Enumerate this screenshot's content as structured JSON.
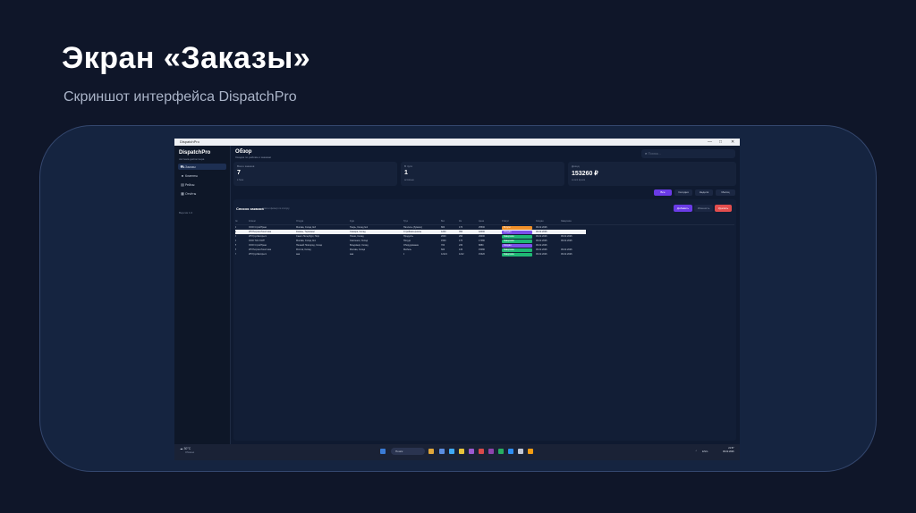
{
  "slide": {
    "title": "Экран «Заказы»",
    "subtitle": "Скриншот интерфейса DispatchPro"
  },
  "window": {
    "title": "DispatchPro",
    "controls": [
      "—",
      "□",
      "✕"
    ]
  },
  "sidebar": {
    "brand": "DispatchPro",
    "brand_sub": "система диспетчера",
    "items": [
      {
        "label": "Заказы",
        "icon": "truck-icon",
        "active": true
      },
      {
        "label": "Клиенты",
        "icon": "user-icon",
        "active": false
      },
      {
        "label": "Рейсы",
        "icon": "route-icon",
        "active": false
      },
      {
        "label": "Отчёты",
        "icon": "report-icon",
        "active": false
      }
    ],
    "version": "Версия 1.0"
  },
  "main": {
    "title": "Обзор",
    "subtitle": "Сводка по рейсам и заказам",
    "search_placeholder": "Поиск...",
    "cards": [
      {
        "label": "Всего заказов",
        "value": "7",
        "caption": "в базе"
      },
      {
        "label": "В пути",
        "value": "1",
        "caption": "активные"
      },
      {
        "label": "Доход",
        "value": "153260 ₽",
        "caption": "за всё время"
      }
    ],
    "filters": [
      {
        "label": "Все",
        "active": true
      },
      {
        "label": "Сегодня",
        "active": false
      },
      {
        "label": "Неделя",
        "active": false
      },
      {
        "label": "Месяц",
        "active": false
      }
    ],
    "orders": {
      "title": "Список заказов",
      "hint": "поиск и фильтр по статусу",
      "buttons": {
        "add": "Добавить",
        "edit": "Изменить",
        "delete": "Удалить"
      },
      "columns": [
        "№",
        "Клиент",
        "Откуда",
        "Куда",
        "Груз",
        "Вес",
        "Км",
        "Цена",
        "Статус",
        "Создан",
        "Завершён"
      ],
      "rows": [
        [
          "1",
          "ООО СтройТранс",
          "Москва, Склад №3",
          "Тверь, Склад №1",
          "Паллеты (бумага)",
          "800",
          "170",
          "25500",
          "В пути",
          "09.02.2026",
          ""
        ],
        [
          "2",
          "ИП Петров Логистика",
          "Казань, Терминал",
          "Самара, Склад",
          "Стройматериалы",
          "1200",
          "350",
          "42000",
          "Создан",
          "09.02.2026",
          ""
        ],
        [
          "3",
          "ИП ГрузЭкспресс",
          "Санкт-Петербург, Порт",
          "Псков, Склад",
          "Продукты",
          "2000",
          "290",
          "29000",
          "Завершён",
          "09.02.2026",
          "09.02.2026"
        ],
        [
          "4",
          "ООО ТАУ-ТАУП",
          "Москва, Склад №1",
          "Смоленск, Склад",
          "Посуда",
          "1500",
          "170",
          "17480",
          "Завершён",
          "09.02.2026",
          "09.02.2026"
        ],
        [
          "5",
          "ООО СтройТранс",
          "Нижний Новгород, Склад",
          "Владимир, Склад",
          "Оборудование",
          "700",
          "230",
          "8880",
          "Создан",
          "09.02.2026",
          ""
        ],
        [
          "6",
          "ИП Петров Логистика",
          "Ростов, Склад",
          "Москва, Склад",
          "Мебель",
          "600",
          "130",
          "15080",
          "Завершён",
          "09.02.2026",
          "09.02.2026"
        ],
        [
          "7",
          "ИП ГрузЭкспресс",
          "ааа",
          "ааа",
          "1",
          "12121",
          "1212",
          "15320",
          "Завершён",
          "09.02.2026",
          "09.02.2026"
        ]
      ],
      "selected_row": 1
    }
  },
  "status_colors": {
    "В пути": "#f0902a",
    "Создан": "#7b4fe8",
    "Завершён": "#1fb774"
  },
  "taskbar": {
    "weather_temp": "30°C",
    "weather_desc": "Облачно",
    "search": "Поиск",
    "lang": "ENG",
    "time": "21:57",
    "date": "09.02.2026"
  }
}
